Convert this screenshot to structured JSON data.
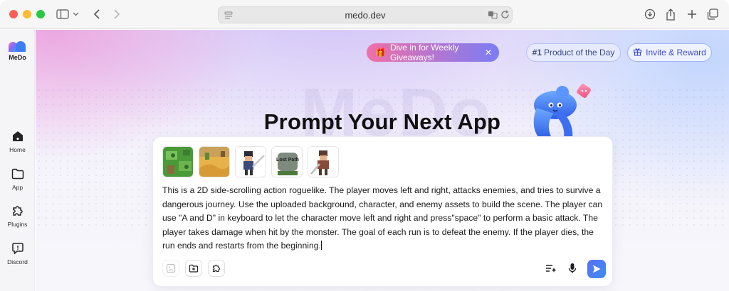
{
  "browser": {
    "url": "medo.dev"
  },
  "sidebar": {
    "logo_text": "MeDo",
    "items": [
      {
        "label": "Home",
        "icon": "home-icon"
      },
      {
        "label": "App",
        "icon": "folder-icon"
      },
      {
        "label": "Plugins",
        "icon": "puzzle-icon"
      },
      {
        "label": "Discord",
        "icon": "chat-icon"
      }
    ]
  },
  "header": {
    "giveaway_label": "Dive in for Weekly Giveaways!",
    "product_rank": "#1",
    "product_label": "Product of the Day",
    "invite_label": "Invite & Reward"
  },
  "hero": {
    "watermark": "MeDo",
    "title": "Prompt Your Next App"
  },
  "prompt": {
    "attachments": [
      "grass-map",
      "desert-map",
      "swordsman",
      "lost-path-sign",
      "warrior"
    ],
    "thumb_sign_text": "Lost Path",
    "text": " This is a 2D side-scrolling action roguelike. The player moves left and right, attacks enemies, and tries to survive a dangerous journey. Use the uploaded background, character, and enemy assets to build the scene. The player can use \"A and D\" in keyboard to let the character move left and right and press\"space\" to perform a basic attack. The player takes damage when hit by the monster. The goal of each run is to defeat the enemy. If the player dies, the run ends and restarts from the beginning."
  },
  "colors": {
    "accent": "#4b6ef5",
    "giveaway_start": "#f06fa8",
    "giveaway_end": "#7a7df5"
  }
}
